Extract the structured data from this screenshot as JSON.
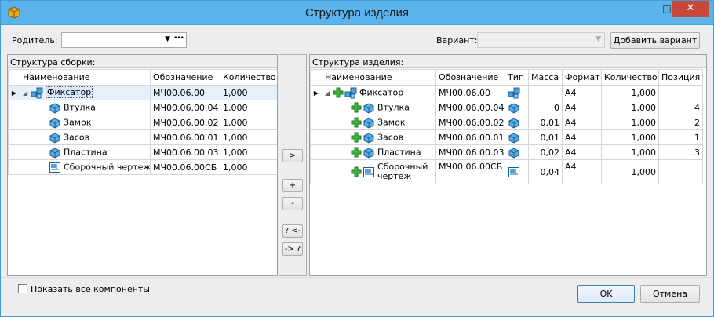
{
  "window": {
    "title": "Структура изделия",
    "close": "✕",
    "minimize": "—",
    "maximize": "□"
  },
  "top": {
    "parent_label": "Родитель:",
    "variant_label": "Вариант:",
    "add_variant": "Добавить вариант",
    "parent_more": "•••"
  },
  "left": {
    "title": "Структура сборки:",
    "columns": [
      "Наименование",
      "Обозначение",
      "Количество"
    ],
    "rows": [
      {
        "name": "Фиксатор",
        "code": "МЧ00.06.00",
        "qty": "1,000"
      },
      {
        "name": "Втулка",
        "code": "МЧ00.06.00.04",
        "qty": "1,000"
      },
      {
        "name": "Замок",
        "code": "МЧ00.06.00.02",
        "qty": "1,000"
      },
      {
        "name": "Засов",
        "code": "МЧ00.06.00.01",
        "qty": "1,000"
      },
      {
        "name": "Пластина",
        "code": "МЧ00.06.00.03",
        "qty": "1,000"
      },
      {
        "name": "Сборочный чертеж",
        "code": "МЧ00.06.00СБ",
        "qty": "1,000"
      }
    ]
  },
  "middle": {
    "move_right": ">",
    "add": "+",
    "remove": "-",
    "find_left": "? <-",
    "find_right": "-> ?"
  },
  "right": {
    "title": "Структура изделия:",
    "columns": [
      "Наименование",
      "Обозначение",
      "Тип",
      "Масса",
      "Формат",
      "Количество",
      "Позиция"
    ],
    "rows": [
      {
        "name": "Фиксатор",
        "code": "МЧ00.06.00",
        "mass": "",
        "format": "А4",
        "qty": "1,000",
        "pos": ""
      },
      {
        "name": "Втулка",
        "code": "МЧ00.06.00.04",
        "mass": "0",
        "format": "А4",
        "qty": "1,000",
        "pos": "4"
      },
      {
        "name": "Замок",
        "code": "МЧ00.06.00.02",
        "mass": "0,01",
        "format": "А4",
        "qty": "1,000",
        "pos": "2"
      },
      {
        "name": "Засов",
        "code": "МЧ00.06.00.01",
        "mass": "0,01",
        "format": "А4",
        "qty": "1,000",
        "pos": "1"
      },
      {
        "name": "Пластина",
        "code": "МЧ00.06.00.03",
        "mass": "0,02",
        "format": "А4",
        "qty": "1,000",
        "pos": "3"
      },
      {
        "name": "Сборочный чертеж",
        "name_line1": "Сборочный",
        "name_line2": "чертеж",
        "code": "МЧ00.06.00СБ",
        "mass": "0,04",
        "format": "А4",
        "qty": "1,000",
        "pos": ""
      }
    ]
  },
  "footer": {
    "show_all": "Показать все компоненты",
    "ok": "OK",
    "cancel": "Отмена"
  },
  "colors": {
    "titlebar": "#5ab3ea",
    "close": "#c7483a",
    "selected_row": "#e6f0fb",
    "plus_green": "#3cb43c",
    "part_blue": "#2a7fc4"
  }
}
